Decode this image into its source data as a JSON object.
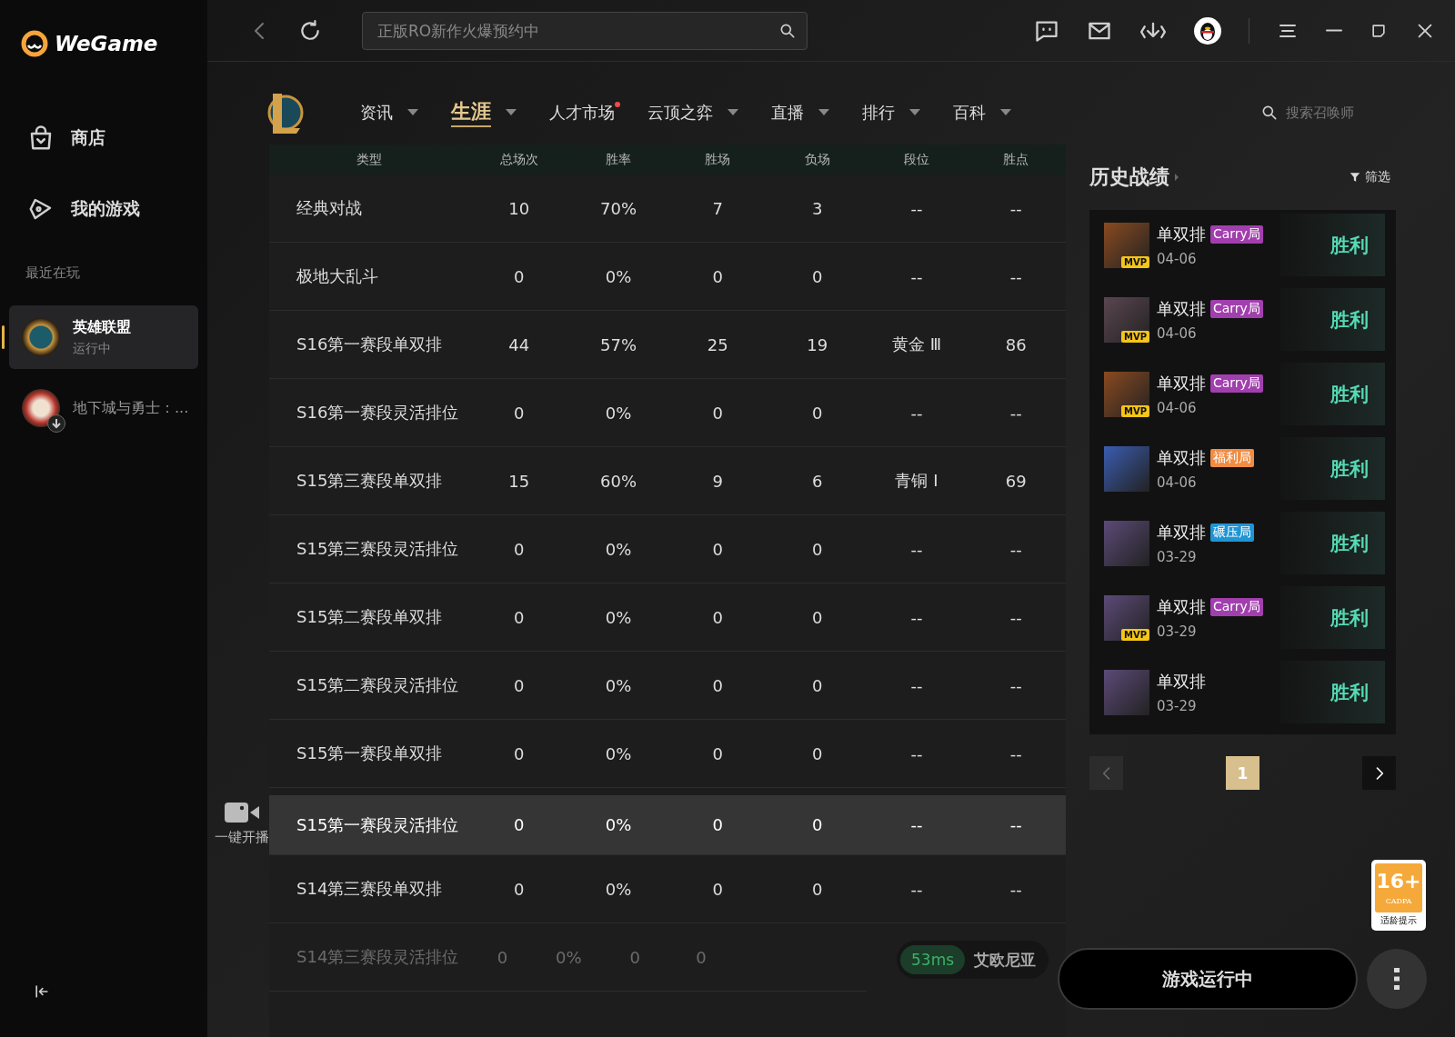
{
  "app": {
    "logo": "WeGame"
  },
  "sidebar": {
    "items": [
      {
        "label": "商店",
        "selected": false
      },
      {
        "label": "我的游戏",
        "selected": false
      }
    ],
    "recent_title": "最近在玩",
    "recent": [
      {
        "name": "英雄联盟",
        "status": "运行中",
        "selected": true,
        "downloading": false
      },
      {
        "name": "地下城与勇士：...",
        "selected": false,
        "downloading": true
      }
    ]
  },
  "topbar": {
    "search": {
      "placeholder": "正版RO新作火爆预约中"
    }
  },
  "nav": {
    "tabs": [
      {
        "label": "资讯",
        "selected": false,
        "dropdown": true,
        "dot": false
      },
      {
        "label": "生涯",
        "selected": true,
        "dropdown": true,
        "dot": false
      },
      {
        "label": "人才市场",
        "selected": false,
        "dropdown": false,
        "dot": true
      },
      {
        "label": "云顶之弈",
        "selected": false,
        "dropdown": true,
        "dot": false
      },
      {
        "label": "直播",
        "selected": false,
        "dropdown": true,
        "dot": false
      },
      {
        "label": "排行",
        "selected": false,
        "dropdown": true,
        "dot": false
      },
      {
        "label": "百科",
        "selected": false,
        "dropdown": true,
        "dot": false
      }
    ],
    "search": {
      "placeholder": "搜索召唤师"
    }
  },
  "table": {
    "columns": [
      "类型",
      "总场次",
      "胜率",
      "胜场",
      "负场",
      "段位",
      "胜点"
    ],
    "rows": [
      {
        "cells": [
          "经典对战",
          "10",
          "70%",
          "7",
          "3",
          "--",
          "--"
        ],
        "highlighted": false,
        "faded": false
      },
      {
        "cells": [
          "极地大乱斗",
          "0",
          "0%",
          "0",
          "0",
          "--",
          "--"
        ],
        "highlighted": false,
        "faded": false
      },
      {
        "cells": [
          "S16第一赛段单双排",
          "44",
          "57%",
          "25",
          "19",
          "黄金 Ⅲ",
          "86"
        ],
        "highlighted": false,
        "faded": false
      },
      {
        "cells": [
          "S16第一赛段灵活排位",
          "0",
          "0%",
          "0",
          "0",
          "--",
          "--"
        ],
        "highlighted": false,
        "faded": false
      },
      {
        "cells": [
          "S15第三赛段单双排",
          "15",
          "60%",
          "9",
          "6",
          "青铜 Ⅰ",
          "69"
        ],
        "highlighted": false,
        "faded": false
      },
      {
        "cells": [
          "S15第三赛段灵活排位",
          "0",
          "0%",
          "0",
          "0",
          "--",
          "--"
        ],
        "highlighted": false,
        "faded": false
      },
      {
        "cells": [
          "S15第二赛段单双排",
          "0",
          "0%",
          "0",
          "0",
          "--",
          "--"
        ],
        "highlighted": false,
        "faded": false
      },
      {
        "cells": [
          "S15第二赛段灵活排位",
          "0",
          "0%",
          "0",
          "0",
          "--",
          "--"
        ],
        "highlighted": false,
        "faded": false
      },
      {
        "cells": [
          "S15第一赛段单双排",
          "0",
          "0%",
          "0",
          "0",
          "--",
          "--"
        ],
        "highlighted": false,
        "faded": false
      },
      {
        "cells": [
          "S15第一赛段灵活排位",
          "0",
          "0%",
          "0",
          "0",
          "--",
          "--"
        ],
        "highlighted": true,
        "faded": false
      },
      {
        "cells": [
          "S14第三赛段单双排",
          "0",
          "0%",
          "0",
          "0",
          "--",
          "--"
        ],
        "highlighted": false,
        "faded": false
      },
      {
        "cells": [
          "S14第三赛段灵活排位",
          "0",
          "0%",
          "0",
          "0"
        ],
        "highlighted": false,
        "faded": true
      }
    ]
  },
  "live_button": {
    "label": "一键开播"
  },
  "history": {
    "title": "历史战绩",
    "filter": "筛选",
    "matches": [
      {
        "mode": "单双排",
        "tag": {
          "text": "Carry局",
          "color": "#a23fae"
        },
        "date": "04-06",
        "result": "胜利",
        "badge": "MVP"
      },
      {
        "mode": "单双排",
        "tag": {
          "text": "Carry局",
          "color": "#a23fae"
        },
        "date": "04-06",
        "result": "胜利",
        "badge": "MVP"
      },
      {
        "mode": "单双排",
        "tag": {
          "text": "Carry局",
          "color": "#a23fae"
        },
        "date": "04-06",
        "result": "胜利",
        "badge": "MVP"
      },
      {
        "mode": "单双排",
        "tag": {
          "text": "福利局",
          "color": "#f08c44"
        },
        "date": "04-06",
        "result": "胜利"
      },
      {
        "mode": "单双排",
        "tag": {
          "text": "碾压局",
          "color": "#1f95d4"
        },
        "date": "03-29",
        "result": "胜利"
      },
      {
        "mode": "单双排",
        "tag": {
          "text": "Carry局",
          "color": "#a23fae"
        },
        "date": "03-29",
        "result": "胜利",
        "badge": "MVP"
      },
      {
        "mode": "单双排",
        "date": "03-29",
        "result": "胜利"
      }
    ],
    "pagination": {
      "prev_disabled": true,
      "pages": [
        {
          "label": "1",
          "selected": true
        }
      ],
      "next_disabled": false
    }
  },
  "footer": {
    "ping": "53ms",
    "server": "艾欧尼亚",
    "run_button": "游戏运行中"
  },
  "age_badge": {
    "rating": "16+",
    "org": "CADPA",
    "caption": "适龄提示"
  }
}
